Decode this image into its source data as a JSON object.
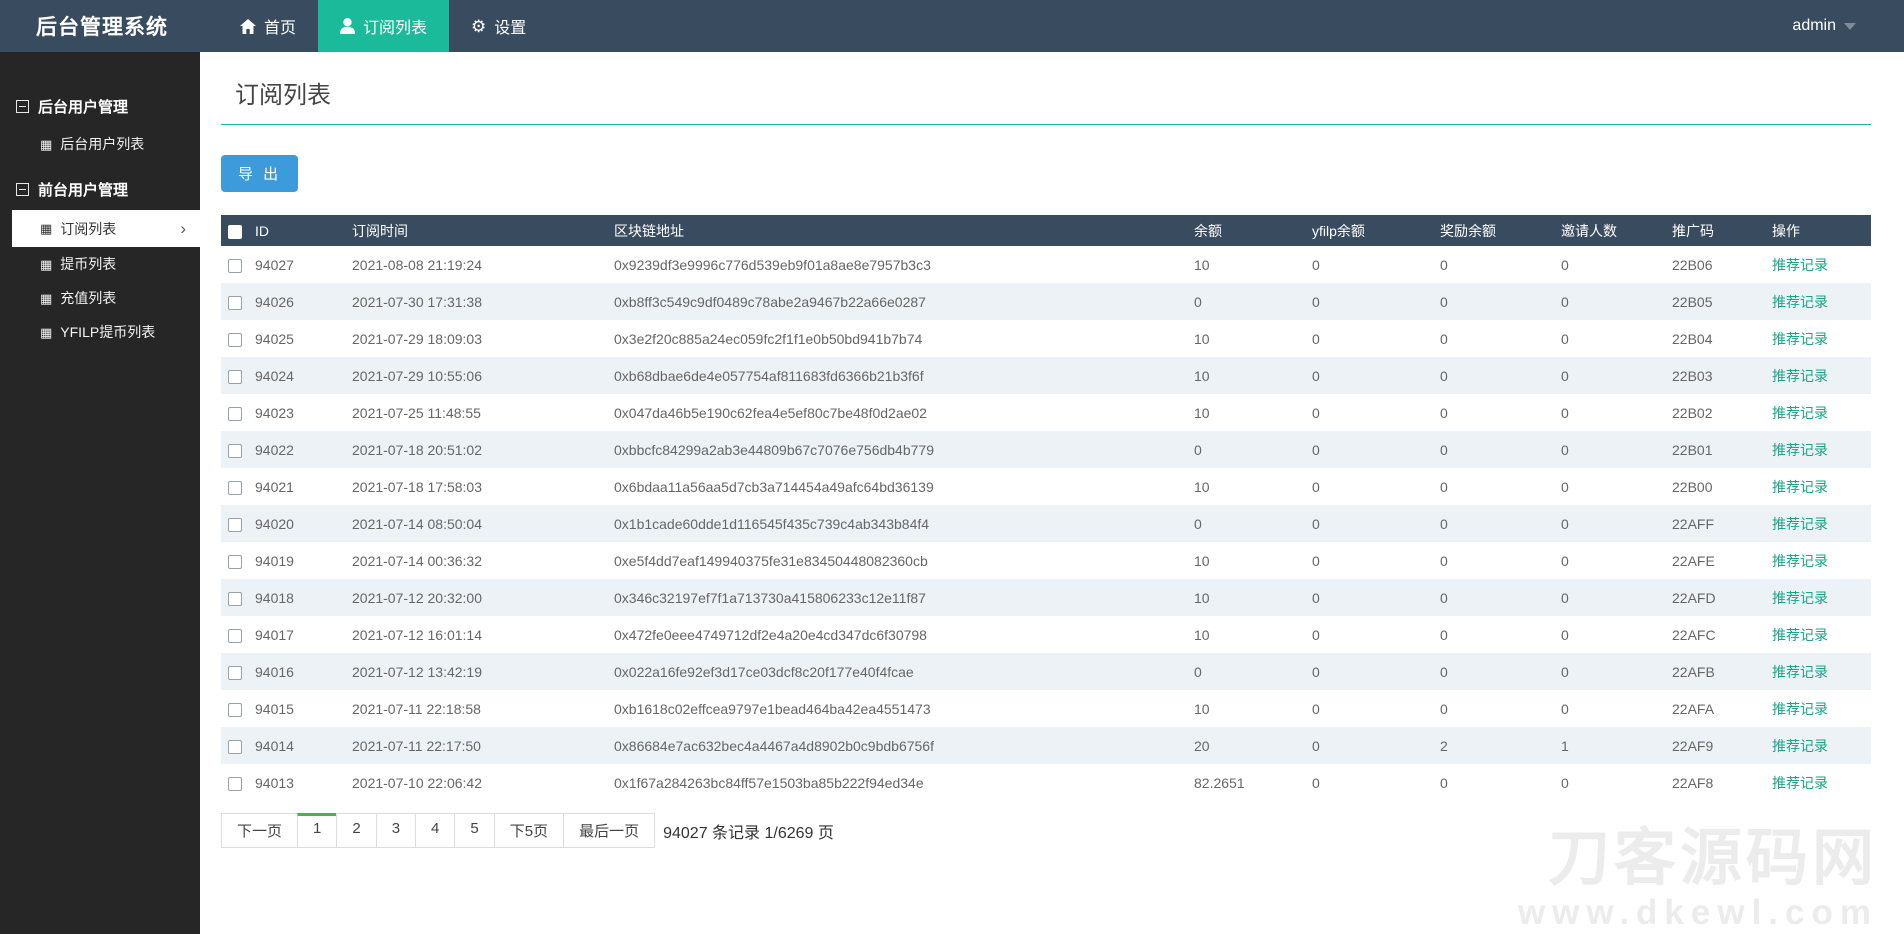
{
  "navbar": {
    "brand": "后台管理系统",
    "items": [
      {
        "label": "首页",
        "icon": "home-icon",
        "active": false
      },
      {
        "label": "订阅列表",
        "icon": "user-icon",
        "active": true
      },
      {
        "label": "设置",
        "icon": "gear-icon",
        "active": false
      }
    ],
    "user": "admin"
  },
  "sidebar": {
    "groups": [
      {
        "label": "后台用户管理",
        "items": [
          {
            "label": "后台用户列表",
            "active": false
          }
        ]
      },
      {
        "label": "前台用户管理",
        "items": [
          {
            "label": "订阅列表",
            "active": true
          },
          {
            "label": "提币列表",
            "active": false
          },
          {
            "label": "充值列表",
            "active": false
          },
          {
            "label": "YFILP提币列表",
            "active": false
          }
        ]
      }
    ]
  },
  "page": {
    "title": "订阅列表",
    "export_label": "导 出"
  },
  "table": {
    "headers": [
      "ID",
      "订阅时间",
      "区块链地址",
      "余额",
      "yfilp余额",
      "奖励余额",
      "邀请人数",
      "推广码",
      "操作"
    ],
    "action_label": "推荐记录",
    "rows": [
      {
        "id": "94027",
        "time": "2021-08-08 21:19:24",
        "address": "0x9239df3e9996c776d539eb9f01a8ae8e7957b3c3",
        "balance": "10",
        "yfilp": "0",
        "reward": "0",
        "invites": "0",
        "code": "22B06"
      },
      {
        "id": "94026",
        "time": "2021-07-30 17:31:38",
        "address": "0xb8ff3c549c9df0489c78abe2a9467b22a66e0287",
        "balance": "0",
        "yfilp": "0",
        "reward": "0",
        "invites": "0",
        "code": "22B05"
      },
      {
        "id": "94025",
        "time": "2021-07-29 18:09:03",
        "address": "0x3e2f20c885a24ec059fc2f1f1e0b50bd941b7b74",
        "balance": "10",
        "yfilp": "0",
        "reward": "0",
        "invites": "0",
        "code": "22B04"
      },
      {
        "id": "94024",
        "time": "2021-07-29 10:55:06",
        "address": "0xb68dbae6de4e057754af811683fd6366b21b3f6f",
        "balance": "10",
        "yfilp": "0",
        "reward": "0",
        "invites": "0",
        "code": "22B03"
      },
      {
        "id": "94023",
        "time": "2021-07-25 11:48:55",
        "address": "0x047da46b5e190c62fea4e5ef80c7be48f0d2ae02",
        "balance": "10",
        "yfilp": "0",
        "reward": "0",
        "invites": "0",
        "code": "22B02"
      },
      {
        "id": "94022",
        "time": "2021-07-18 20:51:02",
        "address": "0xbbcfc84299a2ab3e44809b67c7076e756db4b779",
        "balance": "0",
        "yfilp": "0",
        "reward": "0",
        "invites": "0",
        "code": "22B01"
      },
      {
        "id": "94021",
        "time": "2021-07-18 17:58:03",
        "address": "0x6bdaa11a56aa5d7cb3a714454a49afc64bd36139",
        "balance": "10",
        "yfilp": "0",
        "reward": "0",
        "invites": "0",
        "code": "22B00"
      },
      {
        "id": "94020",
        "time": "2021-07-14 08:50:04",
        "address": "0x1b1cade60dde1d116545f435c739c4ab343b84f4",
        "balance": "0",
        "yfilp": "0",
        "reward": "0",
        "invites": "0",
        "code": "22AFF"
      },
      {
        "id": "94019",
        "time": "2021-07-14 00:36:32",
        "address": "0xe5f4dd7eaf149940375fe31e83450448082360cb",
        "balance": "10",
        "yfilp": "0",
        "reward": "0",
        "invites": "0",
        "code": "22AFE"
      },
      {
        "id": "94018",
        "time": "2021-07-12 20:32:00",
        "address": "0x346c32197ef7f1a713730a415806233c12e11f87",
        "balance": "10",
        "yfilp": "0",
        "reward": "0",
        "invites": "0",
        "code": "22AFD"
      },
      {
        "id": "94017",
        "time": "2021-07-12 16:01:14",
        "address": "0x472fe0eee4749712df2e4a20e4cd347dc6f30798",
        "balance": "10",
        "yfilp": "0",
        "reward": "0",
        "invites": "0",
        "code": "22AFC"
      },
      {
        "id": "94016",
        "time": "2021-07-12 13:42:19",
        "address": "0x022a16fe92ef3d17ce03dcf8c20f177e40f4fcae",
        "balance": "0",
        "yfilp": "0",
        "reward": "0",
        "invites": "0",
        "code": "22AFB"
      },
      {
        "id": "94015",
        "time": "2021-07-11 22:18:58",
        "address": "0xb1618c02effcea9797e1bead464ba42ea4551473",
        "balance": "10",
        "yfilp": "0",
        "reward": "0",
        "invites": "0",
        "code": "22AFA"
      },
      {
        "id": "94014",
        "time": "2021-07-11 22:17:50",
        "address": "0x86684e7ac632bec4a4467a4d8902b0c9bdb6756f",
        "balance": "20",
        "yfilp": "0",
        "reward": "2",
        "invites": "1",
        "code": "22AF9"
      },
      {
        "id": "94013",
        "time": "2021-07-10 22:06:42",
        "address": "0x1f67a284263bc84ff57e1503ba85b222f94ed34e",
        "balance": "82.2651",
        "yfilp": "0",
        "reward": "0",
        "invites": "0",
        "code": "22AF8"
      }
    ]
  },
  "pagination": {
    "buttons": [
      "下一页",
      "1",
      "2",
      "3",
      "4",
      "5",
      "下5页",
      "最后一页"
    ],
    "active": "1",
    "info": "94027 条记录 1/6269 页"
  },
  "watermark": {
    "line1": "刀客源码网",
    "line2": "www.dkewl.com"
  },
  "colors": {
    "navbar_bg": "#394b5f",
    "active_nav_bg": "#1aba9b",
    "sidebar_bg": "#262626",
    "title_underline": "#1abc9c",
    "export_btn": "#3d9bdb",
    "stripe": "#edf2f7",
    "link": "#18a689",
    "pager_active_border": "#44b549"
  }
}
